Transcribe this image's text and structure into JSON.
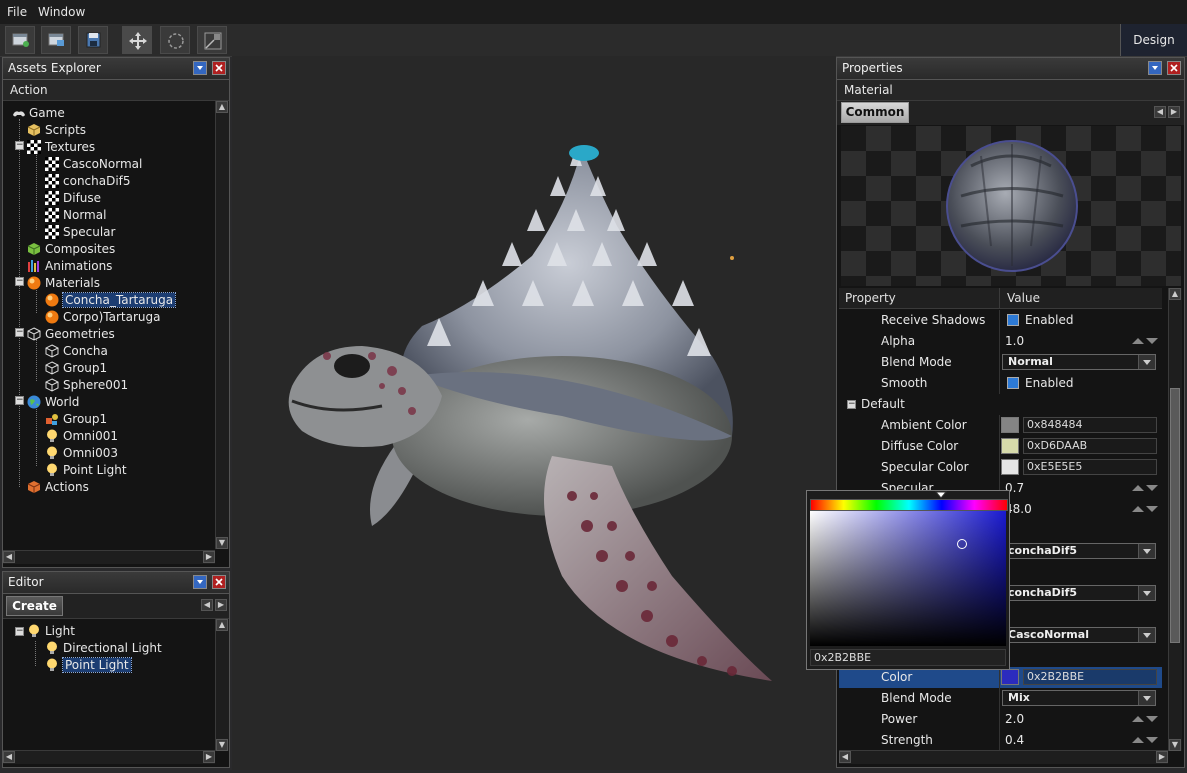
{
  "menu": {
    "file": "File",
    "window": "Window"
  },
  "toolbar": {
    "design_tab": "Design"
  },
  "assets": {
    "title": "Assets Explorer",
    "action_header": "Action",
    "tree": [
      {
        "label": "Game",
        "icon": "gamepad-icon"
      },
      {
        "label": "Scripts",
        "icon": "scripts-icon"
      },
      {
        "label": "Textures",
        "icon": "texture-icon"
      },
      {
        "label": "CascoNormal",
        "icon": "texture-icon"
      },
      {
        "label": "conchaDif5",
        "icon": "texture-icon"
      },
      {
        "label": "Difuse",
        "icon": "texture-icon"
      },
      {
        "label": "Normal",
        "icon": "texture-icon"
      },
      {
        "label": "Specular",
        "icon": "texture-icon"
      },
      {
        "label": "Composites",
        "icon": "composite-icon"
      },
      {
        "label": "Animations",
        "icon": "animation-icon"
      },
      {
        "label": "Materials",
        "icon": "material-icon"
      },
      {
        "label": "Concha_Tartaruga",
        "icon": "material-icon"
      },
      {
        "label": "Corpo)Tartaruga",
        "icon": "material-icon"
      },
      {
        "label": "Geometries",
        "icon": "geometry-icon"
      },
      {
        "label": "Concha",
        "icon": "geometry-icon"
      },
      {
        "label": "Group1",
        "icon": "geometry-icon"
      },
      {
        "label": "Sphere001",
        "icon": "geometry-icon"
      },
      {
        "label": "World",
        "icon": "globe-icon"
      },
      {
        "label": "Group1",
        "icon": "group-icon"
      },
      {
        "label": "Omni001",
        "icon": "light-bulb-icon"
      },
      {
        "label": "Omni003",
        "icon": "light-bulb-icon"
      },
      {
        "label": "Point Light",
        "icon": "light-bulb-icon"
      },
      {
        "label": "Actions",
        "icon": "actions-icon"
      }
    ]
  },
  "editor": {
    "title": "Editor",
    "create_tab": "Create",
    "tree": [
      {
        "label": "Light"
      },
      {
        "label": "Directional Light"
      },
      {
        "label": "Point Light"
      }
    ]
  },
  "properties": {
    "title": "Properties",
    "section": "Material",
    "tab": "Common",
    "col_property": "Property",
    "col_value": "Value",
    "rows": [
      {
        "name": "Receive Shadows",
        "value": "Enabled"
      },
      {
        "name": "Alpha",
        "value": "1.0"
      },
      {
        "name": "Blend Mode",
        "value": "Normal"
      },
      {
        "name": "Smooth",
        "value": "Enabled"
      },
      {
        "name": "Default",
        "value": ""
      },
      {
        "name": "Ambient Color",
        "value": "0x848484",
        "color": "#848484"
      },
      {
        "name": "Diffuse Color",
        "value": "0xD6DAAB",
        "color": "#D6DAAB"
      },
      {
        "name": "Specular Color",
        "value": "0xE5E5E5",
        "color": "#E5E5E5"
      },
      {
        "name": "Specular",
        "value": "0.7"
      },
      {
        "name": "",
        "value": "48.0"
      },
      {
        "name": "",
        "value": "conchaDif5"
      },
      {
        "name": "",
        "value": "conchaDif5"
      },
      {
        "name": "",
        "value": "CascoNormal"
      },
      {
        "name": "Color",
        "value": "0x2B2BBE",
        "color": "#2B2BBE"
      },
      {
        "name": "Blend Mode",
        "value": "Mix"
      },
      {
        "name": "Power",
        "value": "2.0"
      },
      {
        "name": "Strength",
        "value": "0.4"
      }
    ]
  },
  "color_picker": {
    "hex": "0x2B2BBE",
    "base_hue": "#1a1ad0"
  }
}
